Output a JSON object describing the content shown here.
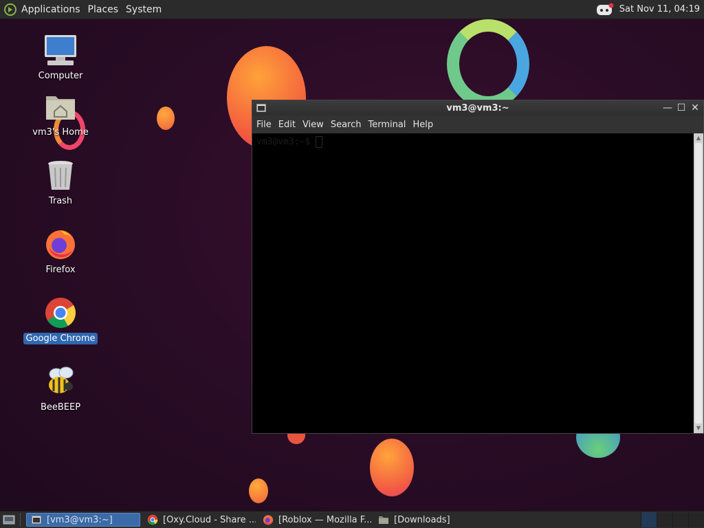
{
  "top_panel": {
    "menus": [
      "Applications",
      "Places",
      "System"
    ],
    "clock": "Sat Nov 11, 04:19",
    "tray_icon": "discord-icon"
  },
  "desktop_icons": [
    {
      "label": "Computer",
      "icon": "computer-icon",
      "selected": false
    },
    {
      "label": "vm3's Home",
      "icon": "home-folder-icon",
      "selected": false
    },
    {
      "label": "Trash",
      "icon": "trash-icon",
      "selected": false
    },
    {
      "label": "Firefox",
      "icon": "firefox-icon",
      "selected": false
    },
    {
      "label": "Google Chrome",
      "icon": "chrome-icon",
      "selected": true
    },
    {
      "label": "BeeBEEP",
      "icon": "beebeep-icon",
      "selected": false
    }
  ],
  "terminal": {
    "title": "vm3@vm3:~",
    "menus": [
      "File",
      "Edit",
      "View",
      "Search",
      "Terminal",
      "Help"
    ],
    "prompt": "vm3@vm3:~$",
    "buttons": {
      "minimize": "—",
      "maximize": "☐",
      "close": "✕"
    }
  },
  "taskbar": {
    "tasks": [
      {
        "label": "[vm3@vm3:~]",
        "icon": "terminal-icon",
        "active": true
      },
      {
        "label": "[Oxy.Cloud - Share ...",
        "icon": "chrome-icon",
        "active": false
      },
      {
        "label": "[Roblox — Mozilla F...",
        "icon": "firefox-icon",
        "active": false
      },
      {
        "label": "[Downloads]",
        "icon": "folder-icon",
        "active": false
      }
    ]
  },
  "colors": {
    "accent": "#2f67b0",
    "panel": "#2b2b2b",
    "desktop": "#2a0c26"
  }
}
